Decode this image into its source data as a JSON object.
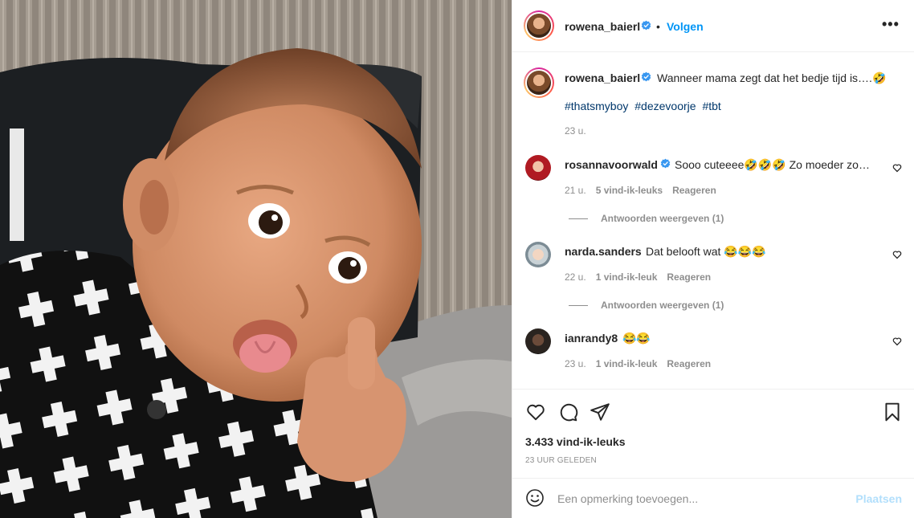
{
  "post": {
    "author": "rowena_baierl",
    "follow_label": "Volgen",
    "dot": "•",
    "more_label": "•••"
  },
  "caption": {
    "username": "rowena_baierl",
    "text": "Wanneer mama zegt dat het bedje tijd is….🤣",
    "hashtags": [
      "#thatsmyboy",
      "#dezevoorje",
      "#tbt"
    ],
    "time": "23 u."
  },
  "comments": [
    {
      "username": "rosannavoorwald",
      "verified": true,
      "text": "Sooo cuteeee🤣🤣🤣 Zo moeder zo…",
      "time": "21 u.",
      "likes": "5 vind-ik-leuks",
      "reply_label": "Reageren",
      "view_replies": "Antwoorden weergeven (1)"
    },
    {
      "username": "narda.sanders",
      "verified": false,
      "text": "Dat belooft wat 😂😂😂",
      "time": "22 u.",
      "likes": "1 vind-ik-leuk",
      "reply_label": "Reageren",
      "view_replies": "Antwoorden weergeven (1)"
    },
    {
      "username": "ianrandy8",
      "verified": false,
      "text": "😂😂",
      "time": "23 u.",
      "likes": "1 vind-ik-leuk",
      "reply_label": "Reageren"
    }
  ],
  "stats": {
    "likes": "3.433 vind-ik-leuks",
    "posted": "23 UUR GELEDEN"
  },
  "add_comment": {
    "placeholder": "Een opmerking toevoegen...",
    "post_label": "Plaatsen"
  },
  "icons": {
    "like": "heart-icon",
    "comment": "comment-bubble-icon",
    "share": "paper-plane-icon",
    "save": "bookmark-icon",
    "emoji": "emoji-smile-icon",
    "verified": "verified-badge-icon"
  },
  "colors": {
    "link_blue": "#0095f6",
    "hashtag_blue": "#00376b",
    "muted": "#8e8e8e",
    "verified": "#3897f0",
    "post_disabled": "#b2dffc"
  }
}
